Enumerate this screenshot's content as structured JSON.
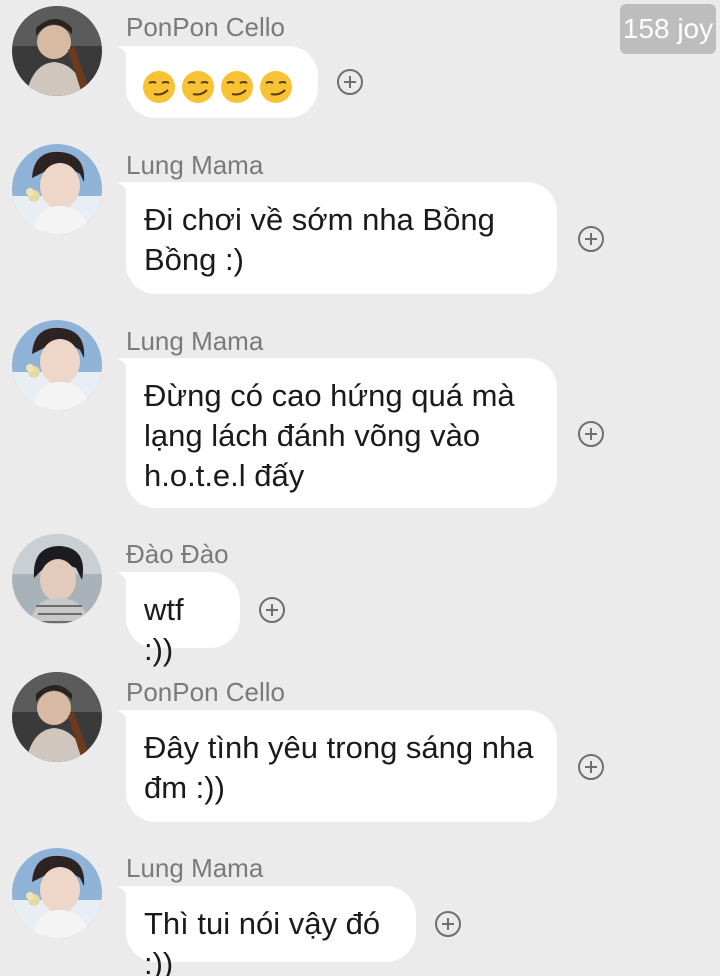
{
  "watermark": "158 joy",
  "messages": [
    {
      "sender": "PonPon Cello",
      "avatar": "avatar-ponpon",
      "type": "emoji",
      "emoji": "smirking-face",
      "emoji_count": 4
    },
    {
      "sender": "Lung Mama",
      "avatar": "avatar-lung",
      "type": "text",
      "lines": [
        "Đi chơi về sớm nha Bồng",
        "Bồng :)"
      ]
    },
    {
      "sender": "Lung Mama",
      "avatar": "avatar-lung",
      "type": "text",
      "lines": [
        "Đừng có cao hứng quá mà",
        "lạng lách đánh võng vào",
        "h.o.t.e.l đấy"
      ]
    },
    {
      "sender": "Đào Đào",
      "avatar": "avatar-dao",
      "type": "text",
      "lines": [
        "wtf :))"
      ]
    },
    {
      "sender": "PonPon Cello",
      "avatar": "avatar-ponpon",
      "type": "text",
      "lines": [
        "Đây tình yêu trong sáng nha",
        "đm :))"
      ]
    },
    {
      "sender": "Lung Mama",
      "avatar": "avatar-lung",
      "type": "text",
      "lines": [
        "Thì tui nói vậy đó :))"
      ]
    }
  ],
  "colors": {
    "background": "#ebebeb",
    "bubble": "#ffffff",
    "sender_text": "#7a7a7a",
    "message_text": "#1a1a1a"
  },
  "icons": [
    "add-reaction-icon",
    "smirking-face-emoji"
  ]
}
